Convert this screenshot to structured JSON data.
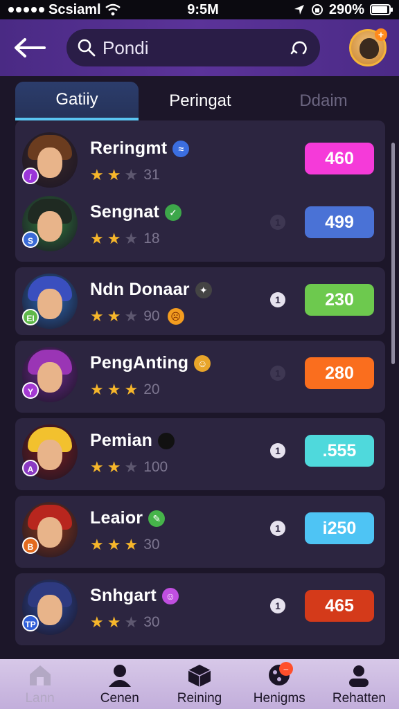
{
  "status_bar": {
    "carrier": "Scsiaml",
    "time": "9:5M",
    "battery": "290%"
  },
  "header": {
    "search_value": "Pondi"
  },
  "tabs": [
    {
      "label": "Gatiiy",
      "active": true
    },
    {
      "label": "Peringat",
      "active": false
    },
    {
      "label": "Ddaim",
      "active": false
    }
  ],
  "players": [
    {
      "name": "Reringmt",
      "stars": 2,
      "star_count": "31",
      "score": "460",
      "score_color": "#f53ad9",
      "rank_marker": "",
      "hair": "#6b3c1f"
    },
    {
      "name": "Sengnat",
      "stars": 2,
      "star_count": "18",
      "score": "499",
      "score_color": "#4a72d6",
      "rank_marker": "1",
      "hair": "#1f2a22"
    },
    {
      "name": "Ndn Donaar",
      "stars": 2,
      "star_count": "90",
      "score": "230",
      "score_color": "#6dc94e",
      "rank_marker": "1",
      "hair": "#3a4fbf"
    },
    {
      "name": "PengAnting",
      "stars": 3,
      "star_count": "20",
      "score": "280",
      "score_color": "#fa6e1e",
      "rank_marker": "1",
      "hair": "#9a35b5"
    },
    {
      "name": "Pemian",
      "stars": 2,
      "star_count": "100",
      "score": ".555",
      "score_color": "#4fd9dc",
      "rank_marker": "1",
      "hair": "#f2c12e"
    },
    {
      "name": "Leaior",
      "stars": 3,
      "star_count": "30",
      "score": "i250",
      "score_color": "#4ec4f4",
      "rank_marker": "1",
      "hair": "#b8261e"
    },
    {
      "name": "Snhgart",
      "stars": 2,
      "star_count": "30",
      "score": "465",
      "score_color": "#d43a1a",
      "rank_marker": "1",
      "hair": "#2e3a80"
    }
  ],
  "bottom_nav": [
    {
      "label": "Lann",
      "icon": "home-icon",
      "active": true
    },
    {
      "label": "Cenen",
      "icon": "person-icon",
      "active": false
    },
    {
      "label": "Reining",
      "icon": "cube-icon",
      "active": false
    },
    {
      "label": "Henigms",
      "icon": "dots-icon",
      "active": false,
      "badge": ""
    },
    {
      "label": "Rehatten",
      "icon": "profile-icon",
      "active": false
    }
  ]
}
